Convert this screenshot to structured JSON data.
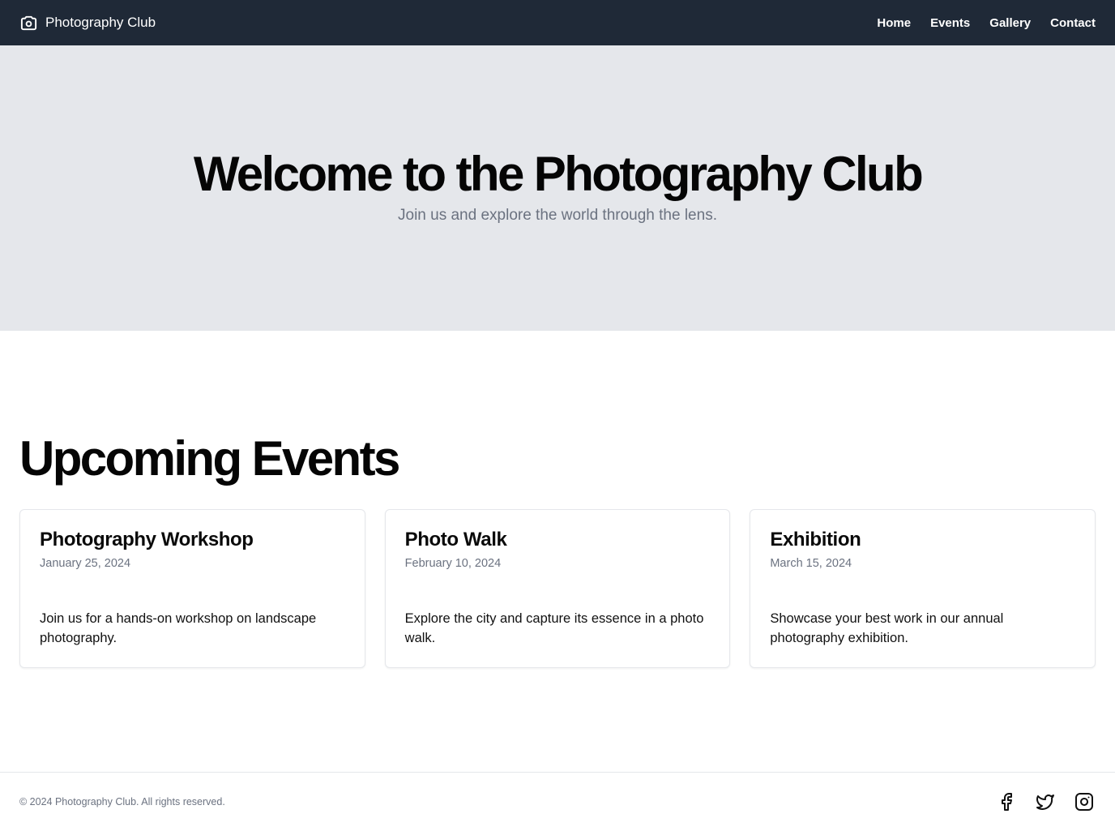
{
  "header": {
    "brand": "Photography Club",
    "brand_icon": "camera-icon",
    "nav": [
      "Home",
      "Events",
      "Gallery",
      "Contact"
    ]
  },
  "hero": {
    "title": "Welcome to the Photography Club",
    "subtitle": "Join us and explore the world through the lens."
  },
  "events": {
    "title": "Upcoming Events",
    "cards": [
      {
        "title": "Photography Workshop",
        "date": "January 25, 2024",
        "description": "Join us for a hands-on workshop on landscape photography."
      },
      {
        "title": "Photo Walk",
        "date": "February 10, 2024",
        "description": "Explore the city and capture its essence in a photo walk."
      },
      {
        "title": "Exhibition",
        "date": "March 15, 2024",
        "description": "Showcase your best work in our annual photography exhibition."
      }
    ]
  },
  "footer": {
    "copyright": "© 2024 Photography Club. All rights reserved.",
    "social_icons": [
      "facebook-icon",
      "twitter-icon",
      "instagram-icon"
    ]
  },
  "colors": {
    "nav_bg": "#1f2937",
    "hero_bg": "#e5e7eb",
    "muted_text": "#6b7280"
  }
}
